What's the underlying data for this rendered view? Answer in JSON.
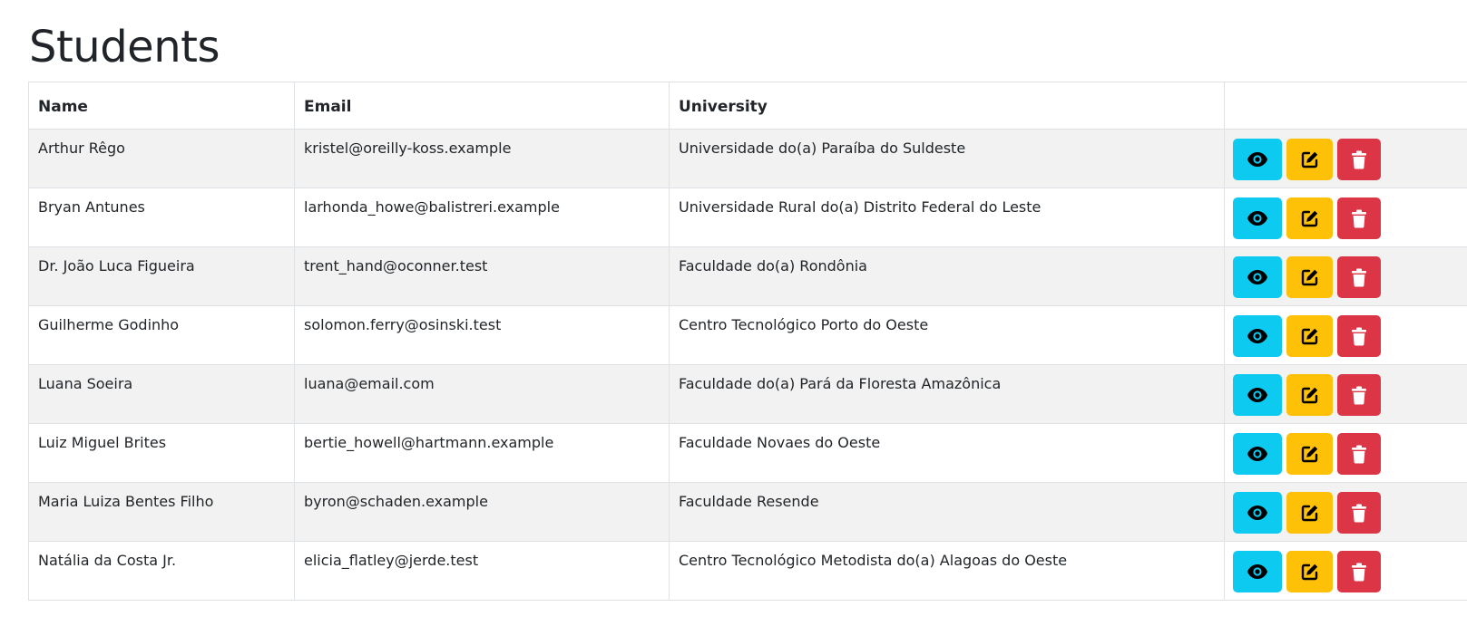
{
  "page": {
    "title": "Students"
  },
  "table": {
    "headers": {
      "name": "Name",
      "email": "Email",
      "university": "University",
      "actions": ""
    },
    "rows": [
      {
        "name": "Arthur Rêgo",
        "email": "kristel@oreilly-koss.example",
        "university": "Universidade do(a) Paraíba do Suldeste"
      },
      {
        "name": "Bryan Antunes",
        "email": "larhonda_howe@balistreri.example",
        "university": "Universidade Rural do(a) Distrito Federal do Leste"
      },
      {
        "name": "Dr. João Luca Figueira",
        "email": "trent_hand@oconner.test",
        "university": "Faculdade do(a) Rondônia"
      },
      {
        "name": "Guilherme Godinho",
        "email": "solomon.ferry@osinski.test",
        "university": "Centro Tecnológico Porto do Oeste"
      },
      {
        "name": "Luana Soeira",
        "email": "luana@email.com",
        "university": "Faculdade do(a) Pará da Floresta Amazônica"
      },
      {
        "name": "Luiz Miguel Brites",
        "email": "bertie_howell@hartmann.example",
        "university": "Faculdade Novaes do Oeste"
      },
      {
        "name": "Maria Luiza Bentes Filho",
        "email": "byron@schaden.example",
        "university": "Faculdade Resende"
      },
      {
        "name": "Natália da Costa Jr.",
        "email": "elicia_flatley@jerde.test",
        "university": "Centro Tecnológico Metodista do(a) Alagoas do Oeste"
      }
    ],
    "actions": {
      "view_icon": "eye-icon",
      "edit_icon": "edit-icon",
      "delete_icon": "trash-icon"
    }
  },
  "colors": {
    "view": "#0dcaf0",
    "edit": "#ffc107",
    "delete": "#dc3545",
    "stripe": "#f2f2f2",
    "border": "#dee2e6"
  }
}
